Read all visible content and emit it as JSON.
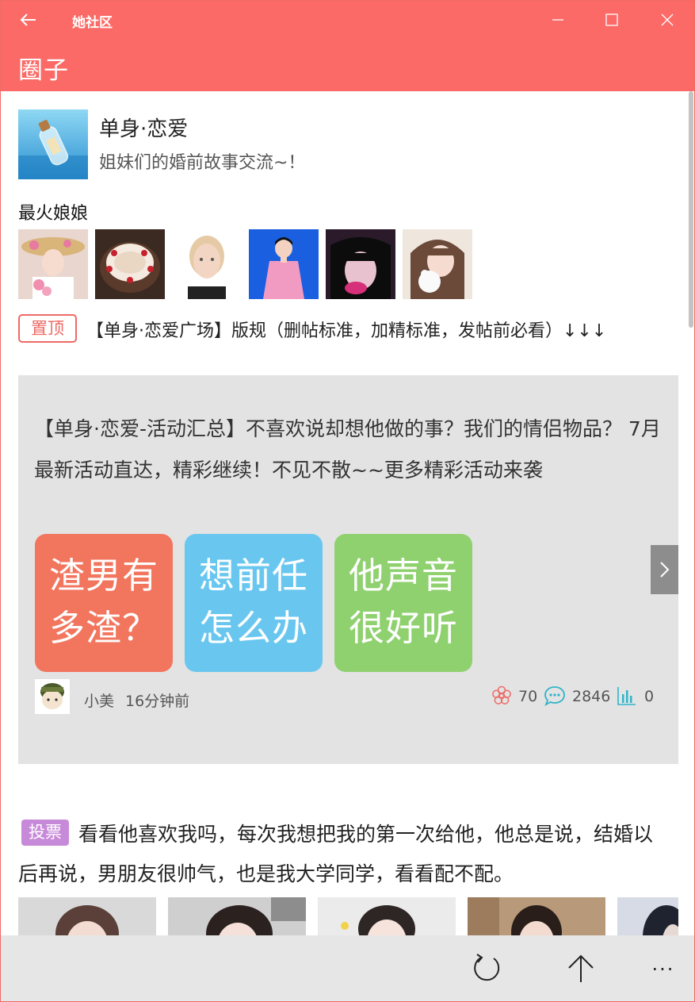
{
  "window": {
    "app_title": "她社区",
    "back_label": "",
    "accent_color": "#fb6a66"
  },
  "header": {
    "title": "圈子"
  },
  "circle": {
    "name": "单身·恋爱",
    "description": "姐妹们的婚前故事交流~！",
    "hot_label": "最火娘娘",
    "avatars": [
      "avatar-hat-girl",
      "avatar-cake",
      "avatar-blonde",
      "avatar-blue-dancer",
      "avatar-dark-hair",
      "avatar-bear-girl"
    ]
  },
  "pinned": {
    "badge": "置顶",
    "title": "【单身·恋爱广场】版规（删帖标准，加精标准，发帖前必看）↓↓↓"
  },
  "featured_post": {
    "text": "【单身·恋爱-活动汇总】不喜欢说却想他做的事？我们的情侣物品？ 7月最新活动直达，精彩继续！不见不散~~更多精彩活动来袭",
    "tiles": [
      {
        "line1": "渣男有",
        "line2": "多渣？",
        "color": "#f2755e"
      },
      {
        "line1": "想前任",
        "line2": "怎么办",
        "color": "#69c7ef"
      },
      {
        "line1": "他声音",
        "line2": "很好听",
        "color": "#8fd16f"
      }
    ],
    "author": "小美",
    "time": "16分钟前",
    "likes": "70",
    "comments": "2846",
    "views": "0"
  },
  "vote_post": {
    "badge": "投票",
    "text": "看看他喜欢我吗，每次我想把我的第一次给他，他总是说，结婚以后再说，男朋友很帅气，也是我大学同学，看看配不配。"
  },
  "bottom_bar": {
    "refresh_icon": "refresh-icon",
    "top_icon": "arrow-up-icon",
    "more_label": "..."
  }
}
